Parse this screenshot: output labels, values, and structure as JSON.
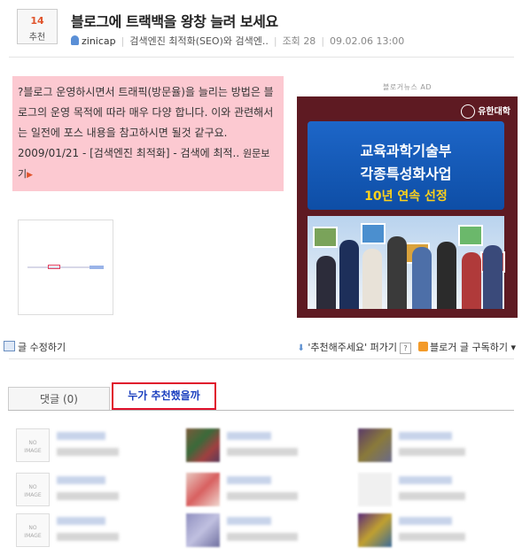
{
  "post": {
    "recommend_count": "14",
    "recommend_label": "추천",
    "title": "블로그에 트랙백을 왕창 늘려 보세요",
    "author": "zinicap",
    "category": "검색엔진 최적화(SEO)와 검색엔..",
    "views_label": "조회",
    "views": "28",
    "date": "09.02.06 13:00"
  },
  "summary": {
    "text": "?블로그 운영하시면서 트래픽(방문율)을 늘리는 방법은 블로그의 운영 목적에 따라 매우 다양 합니다. 이와 관련해서는 일전에 포스 내용을 참고하시면 될것 같구요. 2009/01/21 - [검색엔진 최적화] - 검색에 최적..",
    "more_label": "원문보기"
  },
  "ad": {
    "label": "블로거뉴스 AD",
    "university": "유한대학",
    "line1": "교육과학기술부",
    "line2": "각종특성화사업",
    "line3": "10년 연속 선정"
  },
  "actions": {
    "edit": "글 수정하기",
    "recommend_widget": "'추천해주세요' 퍼가기",
    "help": "?",
    "subscribe": "블로거 글 구독하기",
    "subscribe_arrow": "▾"
  },
  "tabs": {
    "comments": "댓글 (0)",
    "who_recommended": "누가 추천했을까"
  },
  "grid": {
    "noimage_line1": "NO",
    "noimage_line2": "IMAGE"
  },
  "colors": {
    "summary_bg": "#fcc9d1",
    "accent_orange": "#e0542c",
    "tab_highlight_border": "#e0102c",
    "tab_highlight_text": "#1a3fbf",
    "ad_bg": "#5e1a22"
  }
}
